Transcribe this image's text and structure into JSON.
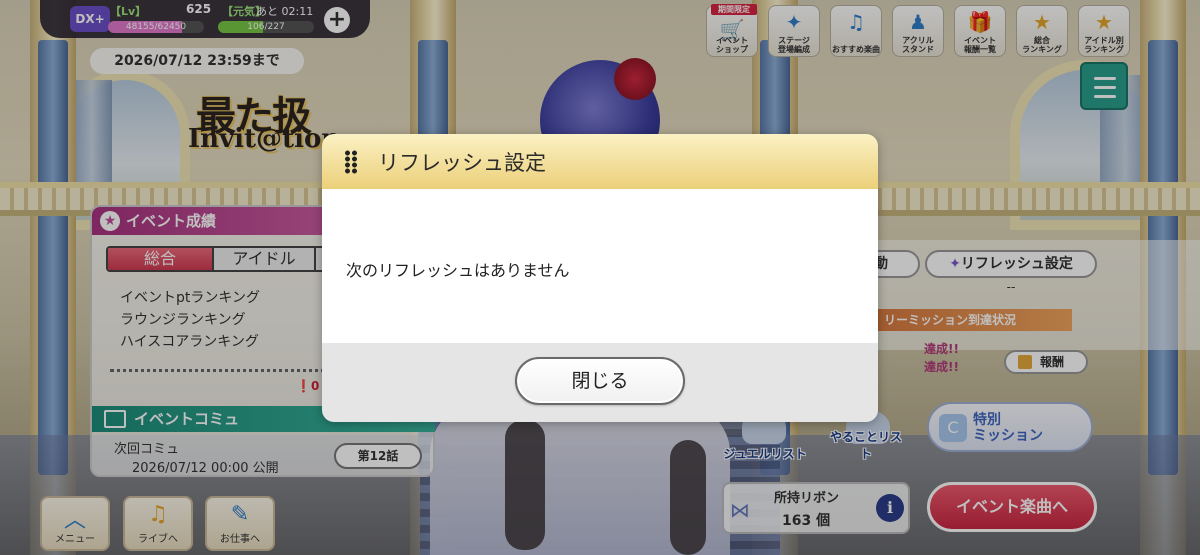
{
  "status": {
    "badge": "DX+",
    "lv_label": "【Lv】",
    "lv_value": "625",
    "exp_text": "48155/62450",
    "exp_fraction": 0.771,
    "stamina_label": "【元気】",
    "stamina_time": "あと 02:11",
    "stamina_text": "106/227",
    "stamina_fraction": 0.467,
    "plus_label": "+"
  },
  "event": {
    "deadline": "2026/07/12 23:59まで",
    "logo_line1": "最た扱",
    "logo_line2": "Invit@tion"
  },
  "top_icons": [
    {
      "tag": "期間限定",
      "label": "イベント\nショップ",
      "glyph": "🛒",
      "icon": "cart-icon"
    },
    {
      "tag": "",
      "label": "ステージ\n登場編成",
      "glyph": "✦",
      "icon": "stage-icon"
    },
    {
      "tag": "",
      "label": "おすすめ楽曲",
      "glyph": "♫",
      "icon": "music-note-icon"
    },
    {
      "tag": "",
      "label": "アクリル\nスタンド",
      "glyph": "♟",
      "icon": "acrylic-stand-icon"
    },
    {
      "tag": "",
      "label": "イベント\n報酬一覧",
      "glyph": "🎁",
      "icon": "gift-icon"
    },
    {
      "tag": "",
      "label": "総合\nランキング",
      "glyph": "★",
      "icon": "ranking-icon"
    },
    {
      "tag": "",
      "label": "アイドル別\nランキング",
      "glyph": "★",
      "icon": "idol-ranking-icon"
    }
  ],
  "event_results": {
    "header": "イベント成績",
    "tabs": [
      "総合",
      "アイドル"
    ],
    "items": [
      "イベントptランキング",
      "ラウンジランキング",
      "ハイスコアランキング"
    ],
    "alert": "0"
  },
  "event_commu": {
    "header": "イベントコミュ",
    "next_label": "次回コミュ",
    "next_date": "2026/07/12 00:00 公開",
    "episode": "第12話"
  },
  "right": {
    "move_label": "動",
    "refresh_label": "リフレッシュ設定",
    "refresh_sub": "--",
    "mission_banner": "リーミッション到達状況",
    "achieved": [
      "達成!!",
      "達成!!"
    ],
    "reward": "報酬",
    "special_mission": "特別\nミッション",
    "jewel_list": "ジュエルリスト",
    "todo_list": "やることリスト",
    "ribbon_label": "所持リボン",
    "ribbon_value": "163 個",
    "info": "i",
    "event_song": "イベント楽曲へ"
  },
  "nav": [
    {
      "label": "メニュー",
      "glyph": "︿",
      "icon": "menu-chevron-icon"
    },
    {
      "label": "ライブへ",
      "glyph": "♫",
      "icon": "live-icon"
    },
    {
      "label": "お仕事へ",
      "glyph": "✎",
      "icon": "work-icon"
    }
  ],
  "dialog": {
    "title": "リフレッシュ設定",
    "message": "次のリフレッシュはありません",
    "close": "閉じる"
  }
}
